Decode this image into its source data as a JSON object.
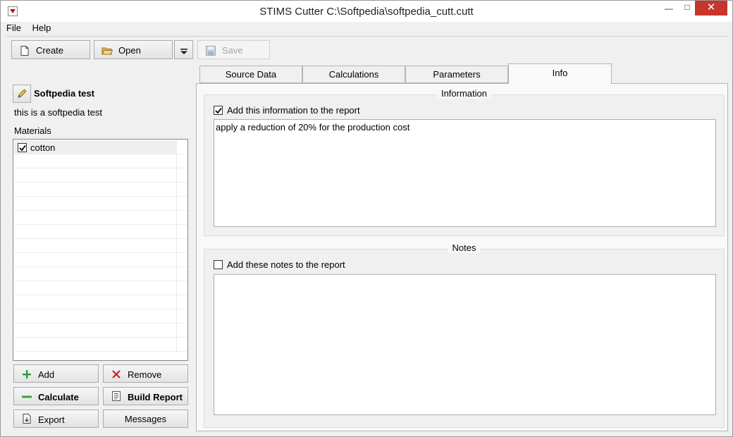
{
  "window": {
    "title": "STIMS Cutter  C:\\Softpedia\\softpedia_cutt.cutt",
    "controls": {
      "minimize": "—",
      "maximize": "□",
      "close": "✕"
    }
  },
  "menu": {
    "file": "File",
    "help": "Help"
  },
  "toolbar": {
    "create_label": "Create",
    "open_label": "Open",
    "save_label": "Save"
  },
  "project": {
    "name": "Softpedia test",
    "description": "this is a softpedia test",
    "materials_label": "Materials",
    "materials": [
      {
        "name": "cotton",
        "checked": true
      }
    ]
  },
  "actions": {
    "add_label": "Add",
    "remove_label": "Remove",
    "calculate_label": "Calculate",
    "build_report_label": "Build Report",
    "export_label": "Export",
    "messages_label": "Messages"
  },
  "tabs": [
    {
      "label": "Source Data",
      "active": false
    },
    {
      "label": "Calculations",
      "active": false
    },
    {
      "label": "Parameters",
      "active": false
    },
    {
      "label": "Info",
      "active": true
    }
  ],
  "info": {
    "information": {
      "title": "Information",
      "checkbox_label": "Add this information to the report",
      "checked": true,
      "text": "apply a reduction of 20% for the production cost"
    },
    "notes": {
      "title": "Notes",
      "checkbox_label": "Add these notes to the report",
      "checked": false,
      "text": ""
    }
  },
  "colors": {
    "add_icon": "#2e9a3a",
    "remove_icon": "#d42020",
    "close_button": "#c7352b",
    "calculate_icon": "#3aa53a",
    "open_icon": "#e8b84a"
  }
}
